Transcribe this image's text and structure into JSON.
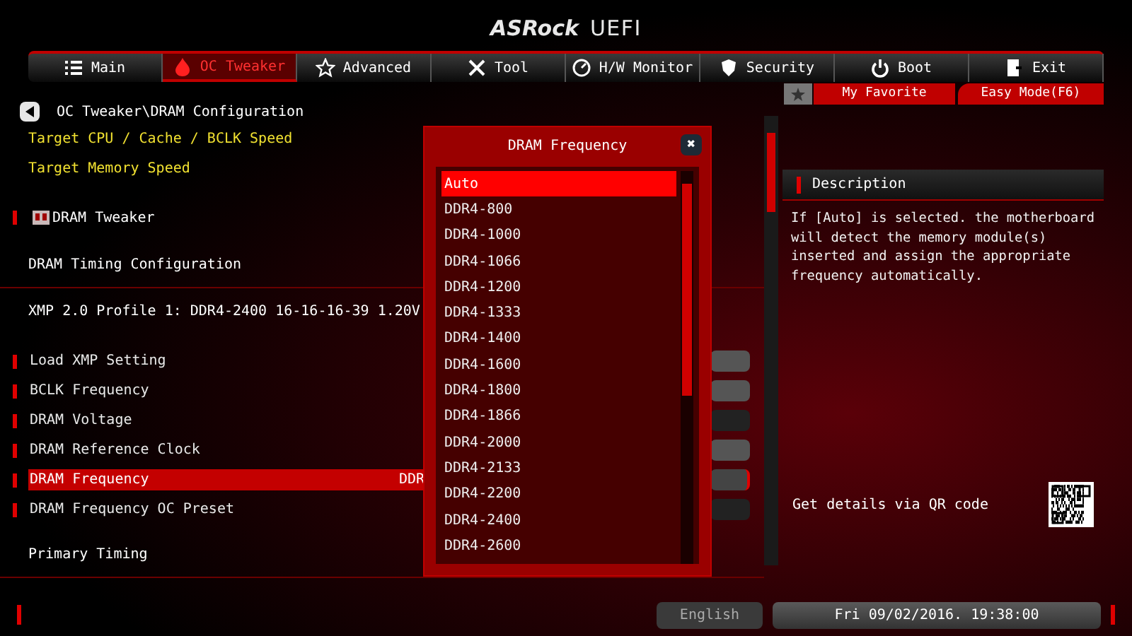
{
  "logo": {
    "brand": "ASRock",
    "product": "UEFI"
  },
  "tabs": [
    {
      "label": "Main",
      "selected": false
    },
    {
      "label": "OC Tweaker",
      "selected": true
    },
    {
      "label": "Advanced",
      "selected": false
    },
    {
      "label": "Tool",
      "selected": false
    },
    {
      "label": "H/W Monitor",
      "selected": false
    },
    {
      "label": "Security",
      "selected": false
    },
    {
      "label": "Boot",
      "selected": false
    },
    {
      "label": "Exit",
      "selected": false
    }
  ],
  "favorite": {
    "label": "My Favorite"
  },
  "easy_mode": {
    "label": "Easy Mode(F6)"
  },
  "breadcrumb": "OC Tweaker\\DRAM Configuration",
  "items": [
    {
      "kind": "info",
      "label": "Target CPU / Cache / BCLK Speed"
    },
    {
      "kind": "info",
      "label": "Target Memory Speed"
    },
    {
      "kind": "submenu",
      "label": "DRAM Tweaker"
    },
    {
      "kind": "section",
      "label": "DRAM Timing Configuration"
    },
    {
      "kind": "text",
      "label": "XMP 2.0 Profile 1: DDR4-2400 16-16-16-39 1.20V"
    },
    {
      "kind": "setting",
      "label": "Load XMP Setting",
      "selected": false
    },
    {
      "kind": "setting",
      "label": "BCLK Frequency",
      "selected": false
    },
    {
      "kind": "setting",
      "label": "DRAM Voltage",
      "selected": false
    },
    {
      "kind": "setting",
      "label": "DRAM Reference Clock",
      "selected": false
    },
    {
      "kind": "setting",
      "label": "DRAM Frequency",
      "selected": true,
      "value": "DDR"
    },
    {
      "kind": "setting",
      "label": "DRAM Frequency OC Preset",
      "selected": false
    },
    {
      "kind": "section",
      "label": "Primary Timing"
    }
  ],
  "popup": {
    "title": "DRAM Frequency",
    "close": "✖",
    "options": [
      {
        "label": "Auto",
        "selected": true
      },
      {
        "label": "DDR4-800",
        "selected": false
      },
      {
        "label": "DDR4-1000",
        "selected": false
      },
      {
        "label": "DDR4-1066",
        "selected": false
      },
      {
        "label": "DDR4-1200",
        "selected": false
      },
      {
        "label": "DDR4-1333",
        "selected": false
      },
      {
        "label": "DDR4-1400",
        "selected": false
      },
      {
        "label": "DDR4-1600",
        "selected": false
      },
      {
        "label": "DDR4-1800",
        "selected": false
      },
      {
        "label": "DDR4-1866",
        "selected": false
      },
      {
        "label": "DDR4-2000",
        "selected": false
      },
      {
        "label": "DDR4-2133",
        "selected": false
      },
      {
        "label": "DDR4-2200",
        "selected": false
      },
      {
        "label": "DDR4-2400",
        "selected": false
      },
      {
        "label": "DDR4-2600",
        "selected": false
      }
    ]
  },
  "description": {
    "title": "Description",
    "text": "If [Auto] is selected. the motherboard will detect the memory module(s) inserted and assign the appropriate frequency automatically.",
    "qr_label": "Get details via QR code"
  },
  "status_bar": {
    "language": "English",
    "datetime": "Fri 09/02/2016. 19:38:00"
  }
}
